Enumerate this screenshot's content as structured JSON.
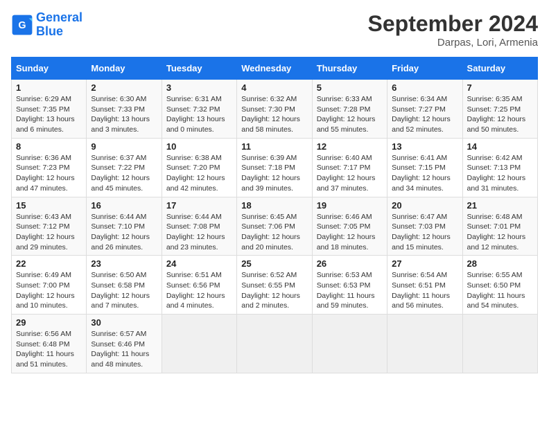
{
  "header": {
    "logo_line1": "General",
    "logo_line2": "Blue",
    "month_title": "September 2024",
    "subtitle": "Darpas, Lori, Armenia"
  },
  "weekdays": [
    "Sunday",
    "Monday",
    "Tuesday",
    "Wednesday",
    "Thursday",
    "Friday",
    "Saturday"
  ],
  "weeks": [
    [
      {
        "day": "1",
        "sunrise": "Sunrise: 6:29 AM",
        "sunset": "Sunset: 7:35 PM",
        "daylight": "Daylight: 13 hours and 6 minutes."
      },
      {
        "day": "2",
        "sunrise": "Sunrise: 6:30 AM",
        "sunset": "Sunset: 7:33 PM",
        "daylight": "Daylight: 13 hours and 3 minutes."
      },
      {
        "day": "3",
        "sunrise": "Sunrise: 6:31 AM",
        "sunset": "Sunset: 7:32 PM",
        "daylight": "Daylight: 13 hours and 0 minutes."
      },
      {
        "day": "4",
        "sunrise": "Sunrise: 6:32 AM",
        "sunset": "Sunset: 7:30 PM",
        "daylight": "Daylight: 12 hours and 58 minutes."
      },
      {
        "day": "5",
        "sunrise": "Sunrise: 6:33 AM",
        "sunset": "Sunset: 7:28 PM",
        "daylight": "Daylight: 12 hours and 55 minutes."
      },
      {
        "day": "6",
        "sunrise": "Sunrise: 6:34 AM",
        "sunset": "Sunset: 7:27 PM",
        "daylight": "Daylight: 12 hours and 52 minutes."
      },
      {
        "day": "7",
        "sunrise": "Sunrise: 6:35 AM",
        "sunset": "Sunset: 7:25 PM",
        "daylight": "Daylight: 12 hours and 50 minutes."
      }
    ],
    [
      {
        "day": "8",
        "sunrise": "Sunrise: 6:36 AM",
        "sunset": "Sunset: 7:23 PM",
        "daylight": "Daylight: 12 hours and 47 minutes."
      },
      {
        "day": "9",
        "sunrise": "Sunrise: 6:37 AM",
        "sunset": "Sunset: 7:22 PM",
        "daylight": "Daylight: 12 hours and 45 minutes."
      },
      {
        "day": "10",
        "sunrise": "Sunrise: 6:38 AM",
        "sunset": "Sunset: 7:20 PM",
        "daylight": "Daylight: 12 hours and 42 minutes."
      },
      {
        "day": "11",
        "sunrise": "Sunrise: 6:39 AM",
        "sunset": "Sunset: 7:18 PM",
        "daylight": "Daylight: 12 hours and 39 minutes."
      },
      {
        "day": "12",
        "sunrise": "Sunrise: 6:40 AM",
        "sunset": "Sunset: 7:17 PM",
        "daylight": "Daylight: 12 hours and 37 minutes."
      },
      {
        "day": "13",
        "sunrise": "Sunrise: 6:41 AM",
        "sunset": "Sunset: 7:15 PM",
        "daylight": "Daylight: 12 hours and 34 minutes."
      },
      {
        "day": "14",
        "sunrise": "Sunrise: 6:42 AM",
        "sunset": "Sunset: 7:13 PM",
        "daylight": "Daylight: 12 hours and 31 minutes."
      }
    ],
    [
      {
        "day": "15",
        "sunrise": "Sunrise: 6:43 AM",
        "sunset": "Sunset: 7:12 PM",
        "daylight": "Daylight: 12 hours and 29 minutes."
      },
      {
        "day": "16",
        "sunrise": "Sunrise: 6:44 AM",
        "sunset": "Sunset: 7:10 PM",
        "daylight": "Daylight: 12 hours and 26 minutes."
      },
      {
        "day": "17",
        "sunrise": "Sunrise: 6:44 AM",
        "sunset": "Sunset: 7:08 PM",
        "daylight": "Daylight: 12 hours and 23 minutes."
      },
      {
        "day": "18",
        "sunrise": "Sunrise: 6:45 AM",
        "sunset": "Sunset: 7:06 PM",
        "daylight": "Daylight: 12 hours and 20 minutes."
      },
      {
        "day": "19",
        "sunrise": "Sunrise: 6:46 AM",
        "sunset": "Sunset: 7:05 PM",
        "daylight": "Daylight: 12 hours and 18 minutes."
      },
      {
        "day": "20",
        "sunrise": "Sunrise: 6:47 AM",
        "sunset": "Sunset: 7:03 PM",
        "daylight": "Daylight: 12 hours and 15 minutes."
      },
      {
        "day": "21",
        "sunrise": "Sunrise: 6:48 AM",
        "sunset": "Sunset: 7:01 PM",
        "daylight": "Daylight: 12 hours and 12 minutes."
      }
    ],
    [
      {
        "day": "22",
        "sunrise": "Sunrise: 6:49 AM",
        "sunset": "Sunset: 7:00 PM",
        "daylight": "Daylight: 12 hours and 10 minutes."
      },
      {
        "day": "23",
        "sunrise": "Sunrise: 6:50 AM",
        "sunset": "Sunset: 6:58 PM",
        "daylight": "Daylight: 12 hours and 7 minutes."
      },
      {
        "day": "24",
        "sunrise": "Sunrise: 6:51 AM",
        "sunset": "Sunset: 6:56 PM",
        "daylight": "Daylight: 12 hours and 4 minutes."
      },
      {
        "day": "25",
        "sunrise": "Sunrise: 6:52 AM",
        "sunset": "Sunset: 6:55 PM",
        "daylight": "Daylight: 12 hours and 2 minutes."
      },
      {
        "day": "26",
        "sunrise": "Sunrise: 6:53 AM",
        "sunset": "Sunset: 6:53 PM",
        "daylight": "Daylight: 11 hours and 59 minutes."
      },
      {
        "day": "27",
        "sunrise": "Sunrise: 6:54 AM",
        "sunset": "Sunset: 6:51 PM",
        "daylight": "Daylight: 11 hours and 56 minutes."
      },
      {
        "day": "28",
        "sunrise": "Sunrise: 6:55 AM",
        "sunset": "Sunset: 6:50 PM",
        "daylight": "Daylight: 11 hours and 54 minutes."
      }
    ],
    [
      {
        "day": "29",
        "sunrise": "Sunrise: 6:56 AM",
        "sunset": "Sunset: 6:48 PM",
        "daylight": "Daylight: 11 hours and 51 minutes."
      },
      {
        "day": "30",
        "sunrise": "Sunrise: 6:57 AM",
        "sunset": "Sunset: 6:46 PM",
        "daylight": "Daylight: 11 hours and 48 minutes."
      },
      null,
      null,
      null,
      null,
      null
    ]
  ]
}
